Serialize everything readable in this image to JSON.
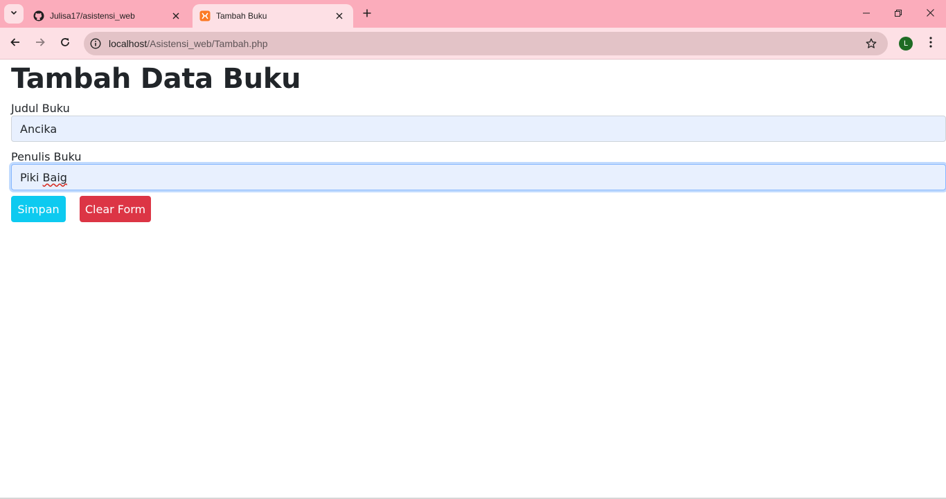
{
  "browser": {
    "tabs": [
      {
        "title": "Julisa17/asistensi_web",
        "icon": "github-icon",
        "active": false
      },
      {
        "title": "Tambah Buku",
        "icon": "xampp-icon",
        "active": true
      }
    ],
    "address": {
      "host": "localhost",
      "path": "/Asistensi_web/Tambah.php"
    },
    "profile_initial": "L",
    "colors": {
      "tabstrip": "#fbacbb",
      "toolbar": "#fde0e5",
      "omnibox": "#e3c3c7",
      "profile": "#1e6b24"
    }
  },
  "page": {
    "heading": "Tambah Data Buku",
    "fields": [
      {
        "label": "Judul Buku",
        "value": "Ancika"
      },
      {
        "label": "Penulis Buku",
        "value_prefix": "Piki ",
        "value_misspelled": "Baig"
      }
    ],
    "buttons": {
      "save_label": "Simpan",
      "clear_label": "Clear Form"
    },
    "colors": {
      "save": "#0dcaf0",
      "clear": "#dc3545",
      "input_bg": "#e8f0fe"
    }
  }
}
